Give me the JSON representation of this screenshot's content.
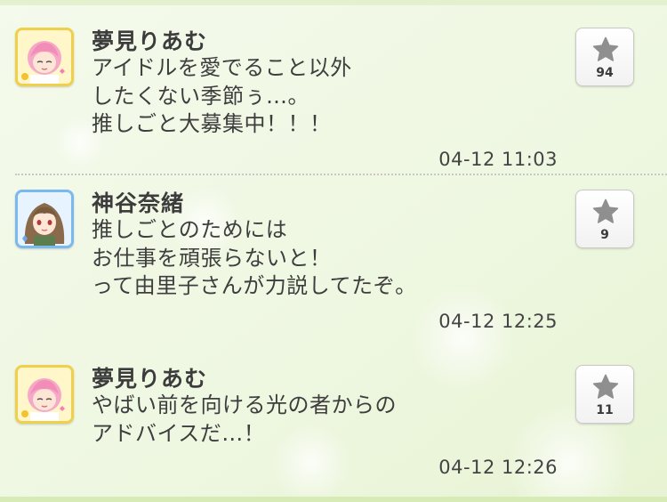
{
  "feed": {
    "posts": [
      {
        "author": "夢見りあむ",
        "avatar_icon": "pink-hair-character-avatar-icon",
        "message_lines": [
          "アイドルを愛でること以外",
          "したくない季節ぅ…。",
          "推しごと大募集中！！！"
        ],
        "timestamp": "04-12 11:03",
        "likes": "94"
      },
      {
        "author": "神谷奈緒",
        "avatar_icon": "brown-hair-character-avatar-icon",
        "message_lines": [
          "推しごとのためには",
          "お仕事を頑張らないと！",
          "って由里子さんが力説してたぞ。"
        ],
        "timestamp": "04-12 12:25",
        "likes": "9"
      },
      {
        "author": "夢見りあむ",
        "avatar_icon": "pink-hair-character-avatar-icon",
        "message_lines": [
          "やばい前を向ける光の者からの",
          "アドバイスだ…！"
        ],
        "timestamp": "04-12 12:26",
        "likes": "11"
      }
    ]
  },
  "colors": {
    "background": "#f3f9e9",
    "text": "#3e3e3e",
    "star": "#8f8f8f",
    "gold_frame": "#f0cf4a",
    "blue_frame": "#7ab8f0"
  }
}
